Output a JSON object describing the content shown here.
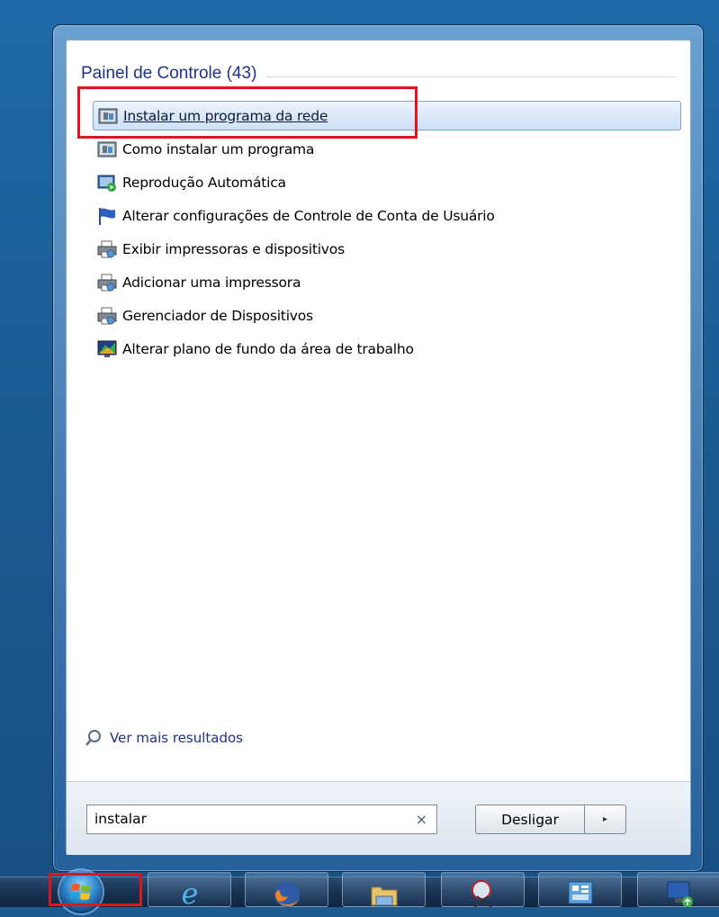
{
  "section": {
    "title": "Painel de Controle (43)"
  },
  "results": [
    {
      "label": "Instalar um programa da rede",
      "icon": "program-install-icon",
      "selected": true
    },
    {
      "label": "Como instalar um programa",
      "icon": "program-install-icon"
    },
    {
      "label": "Reprodução Automática",
      "icon": "autoplay-icon"
    },
    {
      "label": "Alterar configurações de Controle de Conta de Usuário",
      "icon": "uac-flag-icon"
    },
    {
      "label": "Exibir impressoras e dispositivos",
      "icon": "printer-icon"
    },
    {
      "label": "Adicionar uma impressora",
      "icon": "printer-icon"
    },
    {
      "label": "Gerenciador de Dispositivos",
      "icon": "printer-icon"
    },
    {
      "label": "Alterar plano de fundo da área de trabalho",
      "icon": "desktop-background-icon"
    }
  ],
  "more_results": {
    "label": "Ver mais resultados"
  },
  "search": {
    "value": "instalar",
    "clear": "×"
  },
  "shutdown": {
    "label": "Desligar",
    "arrow": "▸"
  },
  "taskbar": {
    "items": [
      "start-orb",
      "internet-explorer-icon",
      "firefox-icon",
      "file-explorer-icon",
      "snipping-tool-icon",
      "control-panel-icon",
      "remote-desktop-icon"
    ]
  },
  "colors": {
    "highlight": "#e0141b",
    "section_title": "#1e3287"
  }
}
